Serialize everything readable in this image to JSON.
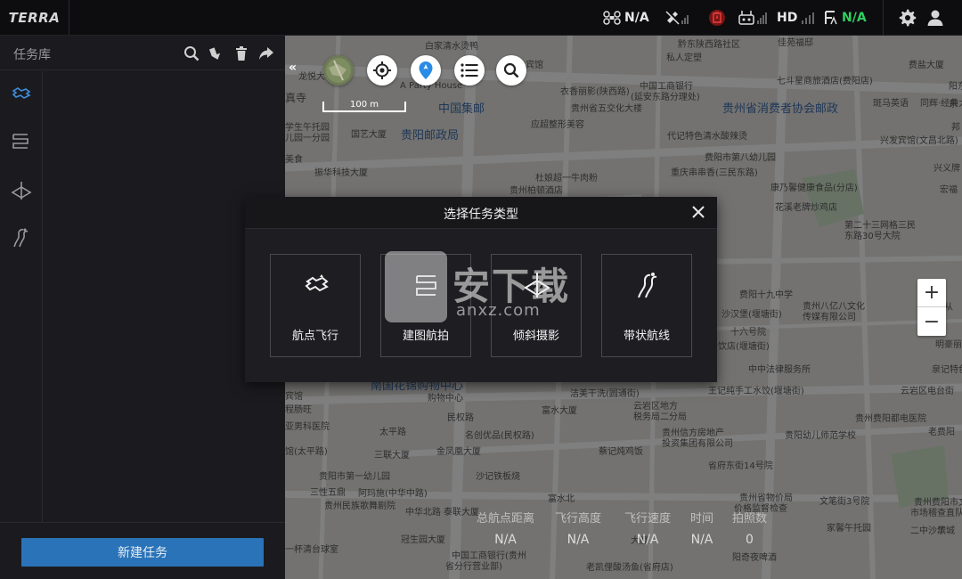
{
  "app": {
    "brand": "TERRA"
  },
  "topbar": {
    "aircraft_status": "N/A",
    "hd_label": "HD",
    "rtk_status": "N/A",
    "rtk_color": "#2fcf5f"
  },
  "sidebar": {
    "title": "任务库",
    "new_task_label": "新建任务",
    "tools": [
      "search-icon",
      "import-icon",
      "delete-icon",
      "share-icon"
    ],
    "rail": [
      "waypoint-flight-icon",
      "mapping-icon",
      "oblique-icon",
      "corridor-icon"
    ]
  },
  "map": {
    "scale": "100 m",
    "labels": [
      "白家清水烫鸭",
      "黔东陕西路社区",
      "佳苑福邸",
      "私人定塑",
      "宾馆",
      "费盐大厦",
      "龙悦大",
      "A Party House",
      "七斗星商旅酒店(费阳店)",
      "阳东",
      "东",
      "衣香丽影(陕西路)",
      "中国工商银行",
      "(延安东路分理处)",
      "真寺",
      "中国集邮",
      "贵州省五交化大楼",
      "贵州省消费者协会邮政",
      "斑马英语",
      "同辉·经典大",
      "学生午托园",
      "应超整形美容",
      "邦",
      "儿园一分园",
      "国艺大厦",
      "贵阳邮政局",
      "代记特色清水酸辣烫",
      "兴发宾馆(文昌北路)",
      "美食",
      "费阳市第八幼儿园",
      "兴义牌",
      "振华科技大厦",
      "杜娘超一牛肉粉",
      "重庆串串香(三民东路)",
      "贵州柏顿酒店",
      "康乃馨健康食品(分店)",
      "宏福",
      "花溪老牌炒鸡店",
      "第二十三网格三民",
      "东路30号大院",
      "费阳十九中学",
      "沙汉堡(堰塘街)",
      "贵州八亿八文化",
      "传媒有限公司",
      "从",
      "十六号院",
      "明豪丽皇(文",
      "饮店(堰塘街)",
      "中中法律服务所",
      "泉记特色",
      "宾馆",
      "南国花锦购物中心",
      "购物中心",
      "洁美干洗(圆通街)",
      "王记纯手工水饺(堰塘街)",
      "云岩区电台街",
      "程肠旺",
      "富水大厦",
      "云岩区地方",
      "税务局二分局",
      "贵州费阳都电医院",
      "亚男科医院",
      "太平路",
      "民权路",
      "贵州信方房地产",
      "投资集团有限公司",
      "贵阳幼儿师范学校",
      "老费阳",
      "三联大厦",
      "名创优品(民权路)",
      "馆(太平路)",
      "金凤凰大厦",
      "蔡记炖鸡饭",
      "省府东街14号院",
      "沙记铁板烧",
      "贵阳市第一幼儿园",
      "三性五鼎",
      "阿玛施(中华中路)",
      "贵州民族歌舞剧院",
      "富水北",
      "泰联大厦",
      "中华北路",
      "贵州省物价局",
      "价格监督检查",
      "文笔街3号院",
      "贵州费阳市文化",
      "市场稽查直队",
      "家馨午托园",
      "二中沙滨",
      "华城",
      "冠生园大厦",
      "一杯清台球室",
      "中国工商银行(贵州",
      "省分行营业部)",
      "老凯俚酸汤鱼(省府店)",
      "阳奇夜啤酒",
      "大厦"
    ],
    "stats": [
      {
        "label": "总航点距离",
        "value": "N/A"
      },
      {
        "label": "飞行高度",
        "value": "N/A"
      },
      {
        "label": "飞行速度",
        "value": "N/A"
      },
      {
        "label": "时间",
        "value": "N/A"
      },
      {
        "label": "拍照数",
        "value": "0"
      }
    ]
  },
  "modal": {
    "title": "选择任务类型",
    "cards": [
      {
        "label": "航点飞行",
        "icon": "waypoint-flight-icon"
      },
      {
        "label": "建图航拍",
        "icon": "mapping-icon"
      },
      {
        "label": "倾斜摄影",
        "icon": "oblique-icon"
      },
      {
        "label": "带状航线",
        "icon": "corridor-icon"
      }
    ]
  },
  "watermark": {
    "text": "安下载",
    "sub": "anxz.com"
  }
}
